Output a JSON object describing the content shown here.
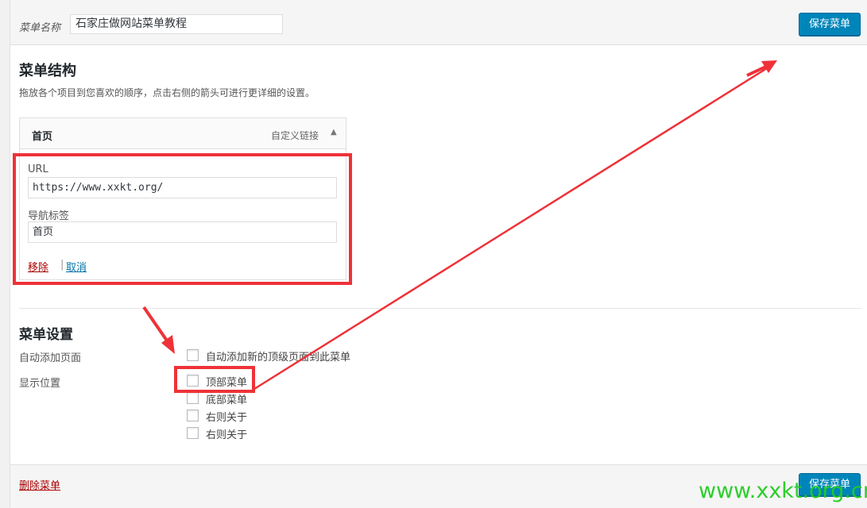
{
  "menu_name": {
    "label": "菜单名称",
    "value": "石家庄做网站菜单教程"
  },
  "buttons": {
    "save": "保存菜单"
  },
  "structure": {
    "title": "菜单结构",
    "description": "拖放各个项目到您喜欢的顺序，点击右侧的箭头可进行更详细的设置。"
  },
  "menu_item": {
    "title": "首页",
    "type": "自定义链接",
    "toggle_icon": "▲",
    "url_label": "URL",
    "url_value": "https://www.xxkt.org/",
    "nav_label_label": "导航标签",
    "nav_label_value": "首页",
    "remove": "移除",
    "separator": "|",
    "cancel": "取消"
  },
  "settings": {
    "title": "菜单设置",
    "auto_add_label": "自动添加页面",
    "auto_add_option": "自动添加新的顶级页面到此菜单",
    "location_label": "显示位置",
    "locations": [
      "顶部菜单",
      "底部菜单",
      "右则关于",
      "右则关于"
    ]
  },
  "footer": {
    "delete": "删除菜单"
  },
  "watermark": "www.xxkt.org.cn",
  "colors": {
    "primary": "#0085ba",
    "highlight": "#ee3238",
    "delete": "#aa0000",
    "link": "#0073aa",
    "watermark": "#22cc22"
  }
}
